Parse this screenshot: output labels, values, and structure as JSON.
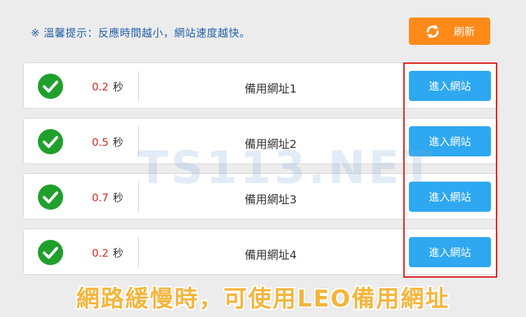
{
  "notice": "※ 溫馨提示：反應時間越小，網站速度越快。",
  "refresh_label": "刷新",
  "time_unit": "秒",
  "rows": [
    {
      "time": "0.2",
      "title": "備用網址1",
      "button": "進入網站"
    },
    {
      "time": "0.5",
      "title": "備用網址2",
      "button": "進入網站"
    },
    {
      "time": "0.7",
      "title": "備用網址3",
      "button": "進入網站"
    },
    {
      "time": "0.2",
      "title": "備用網址4",
      "button": "進入網站"
    }
  ],
  "watermark": "TS113.NET",
  "caption": "網路緩慢時，可使用LEO備用網址",
  "colors": {
    "refresh": "#ff8a1a",
    "enter": "#2ea8f0",
    "check": "#1fa02c",
    "time": "#d9281e",
    "highlight": "#e02020",
    "caption": "#f5b53d"
  }
}
